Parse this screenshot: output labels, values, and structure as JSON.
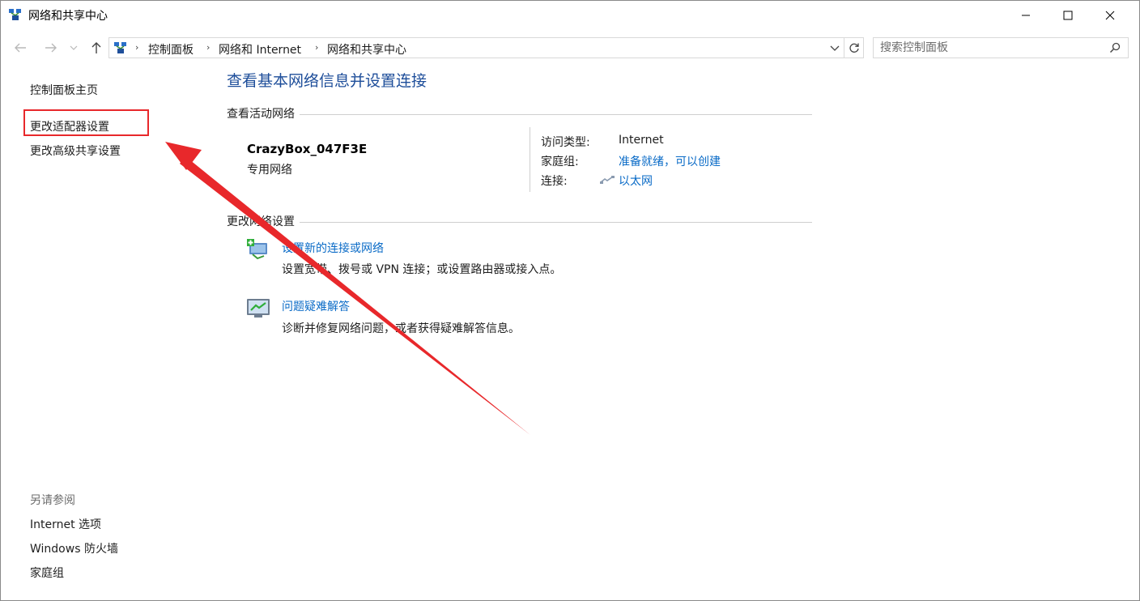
{
  "window": {
    "title": "网络和共享中心",
    "controls": {
      "minimize": "—",
      "maximize": "☐",
      "close": "✕"
    }
  },
  "nav": {
    "breadcrumbs": [
      "控制面板",
      "网络和 Internet",
      "网络和共享中心"
    ],
    "search_placeholder": "搜索控制面板"
  },
  "sidebar": {
    "links": [
      "控制面板主页",
      "更改适配器设置",
      "更改高级共享设置"
    ],
    "highlighted_link": "更改适配器设置",
    "see_also_title": "另请参阅",
    "see_also": [
      "Internet 选项",
      "Windows 防火墙",
      "家庭组"
    ]
  },
  "main": {
    "heading": "查看基本网络信息并设置连接",
    "active_section": "查看活动网络",
    "network": {
      "name": "CrazyBox_047F3E",
      "type": "专用网络",
      "access_type_label": "访问类型:",
      "access_type_value": "Internet",
      "homegroup_label": "家庭组:",
      "homegroup_value": "准备就绪，可以创建",
      "connection_label": "连接:",
      "connection_value": "以太网"
    },
    "change_section": "更改网络设置",
    "tasks": [
      {
        "title": "设置新的连接或网络",
        "desc": "设置宽带、拨号或 VPN 连接；或设置路由器或接入点。"
      },
      {
        "title": "问题疑难解答",
        "desc": "诊断并修复网络问题，或者获得疑难解答信息。"
      }
    ]
  },
  "annotation": {
    "color": "#e8282b"
  }
}
